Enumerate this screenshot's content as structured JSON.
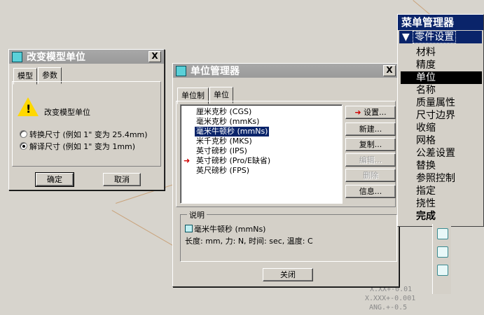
{
  "background": {
    "dims": [
      "X.XX+-0.01",
      "X.XXX+-0.001",
      "ANG.+-0.5"
    ]
  },
  "change_unit_dialog": {
    "title": "改变模型单位",
    "close": "X",
    "tabs": [
      "模型",
      "参数"
    ],
    "message": "改变模型单位",
    "options": [
      "转换尺寸 (例如 1\" 变为 25.4mm)",
      "解译尺寸 (例如 1\" 变为 1mm)"
    ],
    "selected_option": 1,
    "ok": "确定",
    "cancel": "取消"
  },
  "unit_manager": {
    "title": "单位管理器",
    "close": "X",
    "tabs": [
      "单位制",
      "单位"
    ],
    "systems": [
      "厘米克秒 (CGS)",
      "毫米克秒 (mmKs)",
      "毫米牛顿秒 (mmNs)",
      "米千克秒 (MKS)",
      "英寸磅秒 (IPS)",
      "英寸磅秒 (Pro/E缺省)",
      "英尺磅秒 (FPS)"
    ],
    "selected_index": 2,
    "marker_index": 5,
    "buttons": {
      "set": "设置...",
      "new": "新建...",
      "copy": "复制...",
      "edit": "编辑...",
      "delete": "删除",
      "info": "信息..."
    },
    "description_label": "说明",
    "description_name": "毫米牛顿秒 (mmNs)",
    "description_detail": "长度: mm, 力: N, 时间: sec, 温度: C",
    "close_button": "关闭"
  },
  "menu_manager": {
    "title": "菜单管理器",
    "section": "零件设置",
    "items": [
      "材料",
      "精度",
      "单位",
      "名称",
      "质量属性",
      "尺寸边界",
      "收缩",
      "网格",
      "公差设置",
      "替换",
      "参照控制",
      "指定",
      "挠性",
      "完成"
    ],
    "highlighted_index": 2,
    "bold_index": 13
  },
  "colors": {
    "selection": "#0a246a",
    "dialog_face": "#d4d0c8",
    "marker_red": "#d00000",
    "warning_yellow": "#ffd800"
  }
}
